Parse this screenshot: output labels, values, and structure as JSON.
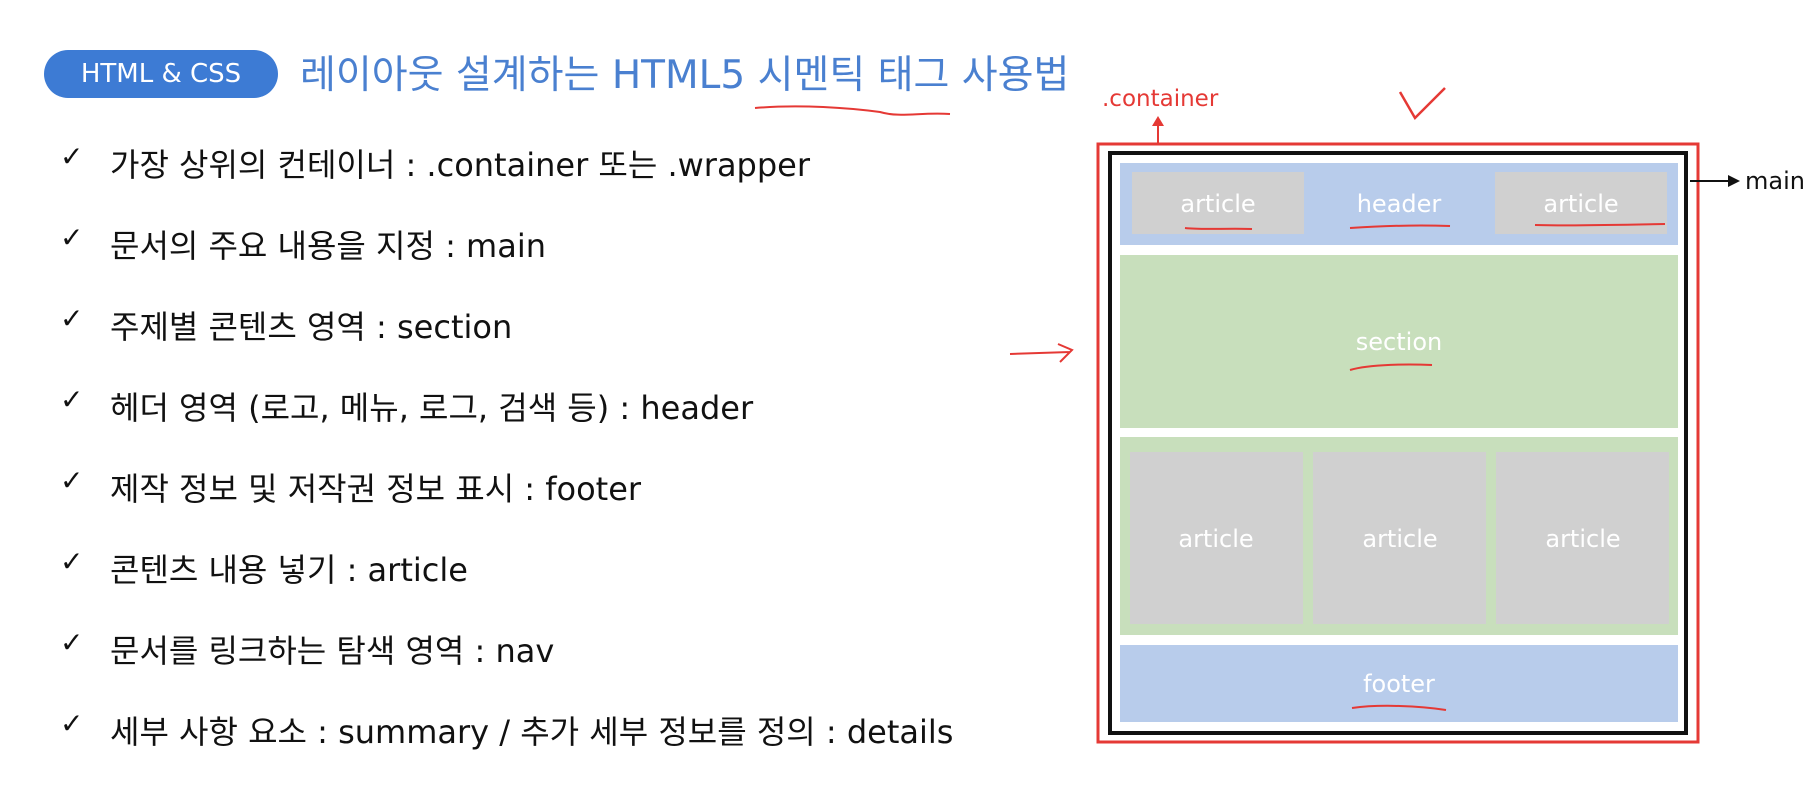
{
  "header": {
    "badge": "HTML & CSS",
    "title": "레이아웃 설계하는 HTML5 시멘틱 태그 사용법"
  },
  "items": [
    "가장 상위의 컨테이너 : .container 또는 .wrapper",
    "문서의 주요 내용을 지정 : main",
    "주제별 콘텐츠 영역 : section",
    "헤더 영역 (로고, 메뉴, 로그, 검색 등) : header",
    "제작 정보 및 저작권 정보 표시 : footer",
    "콘텐츠 내용 넣기 : article",
    "문서를 링크하는 탐색 영역 : nav",
    "세부 사항 요소 : summary  /  추가 세부 정보를 정의 : details"
  ],
  "check_glyph": "✓",
  "diagram": {
    "container_label": ".container",
    "main_label": "main",
    "header_label": "header",
    "section_label": "section",
    "footer_label": "footer",
    "article_label": "article",
    "colors": {
      "outer_border": "#e53935",
      "inner_border": "#111111",
      "blue_block": "#b8cceb",
      "green_block": "#c8dfbc",
      "gray_block": "#d0d0d0",
      "annotation": "#e53935"
    }
  }
}
